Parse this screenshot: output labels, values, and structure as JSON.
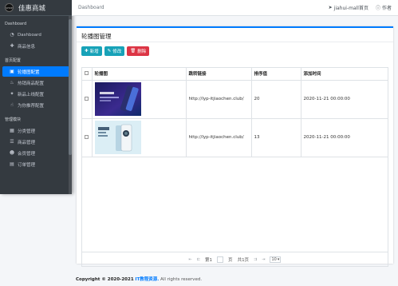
{
  "brand": {
    "name": "佳惠商城",
    "logo_text": "SHOP"
  },
  "sidebar": {
    "sections": [
      {
        "title": "Dashboard",
        "items": [
          {
            "label": "Dashboard",
            "icon": "dashboard-icon",
            "active": false
          },
          {
            "label": "商品信息",
            "icon": "plus-icon",
            "active": false
          }
        ]
      },
      {
        "title": "首页配置",
        "items": [
          {
            "label": "轮播图配置",
            "icon": "image-icon",
            "active": true
          },
          {
            "label": "热销商品配置",
            "icon": "fire-icon",
            "active": false
          },
          {
            "label": "新品上线配置",
            "icon": "star-icon",
            "active": false
          },
          {
            "label": "为你推荐配置",
            "icon": "thumbs-up-icon",
            "active": false
          }
        ]
      },
      {
        "title": "管理模块",
        "items": [
          {
            "label": "分类管理",
            "icon": "grid-icon",
            "active": false
          },
          {
            "label": "商品管理",
            "icon": "list-icon",
            "active": false
          },
          {
            "label": "会员管理",
            "icon": "users-icon",
            "active": false
          },
          {
            "label": "订单管理",
            "icon": "order-icon",
            "active": false
          }
        ]
      }
    ]
  },
  "header": {
    "breadcrumb": "Dashboard",
    "mall_link": "jiahui-mall首页",
    "author": "作者"
  },
  "card": {
    "title": "轮播图管理",
    "buttons": {
      "add": "新增",
      "edit": "修改",
      "delete": "删除"
    }
  },
  "table": {
    "columns": [
      "轮播图",
      "跳转链接",
      "排序值",
      "添加时间"
    ],
    "rows": [
      {
        "link": "http://lyp-itjiaochen.club/",
        "sort": "20",
        "time": "2020-11-21 00:00:00"
      },
      {
        "link": "http://lyp-itjiaochen.club/",
        "sort": "13",
        "time": "2020-11-21 00:00:00"
      }
    ]
  },
  "pager": {
    "page_prefix": "第1",
    "page_suffix": "页",
    "total": "共1页",
    "page_size": "10"
  },
  "footer": {
    "copyright": "Copyright © 2020-2021",
    "site": "IT教程资源.",
    "rights": "All rights reserved."
  },
  "colors": {
    "accent": "#007bff",
    "info": "#17a2b8",
    "danger": "#dc3545",
    "sidebar": "#343a40"
  }
}
